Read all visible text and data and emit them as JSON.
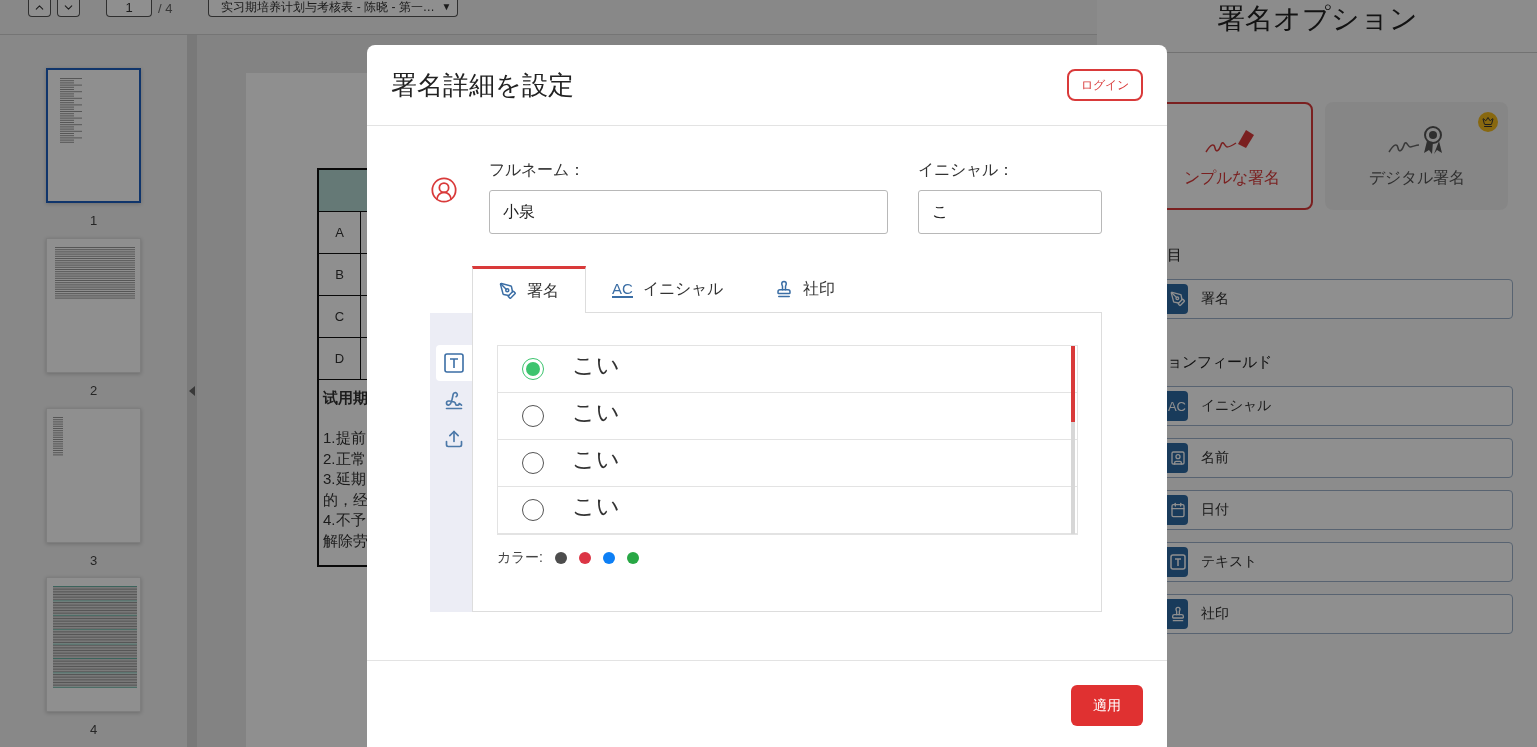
{
  "toolbar": {
    "page_input": "1",
    "page_total": "/ 4",
    "document_select": "实习期培养计划与考核表 - 陈晓 - 第一…",
    "select_caret": "▼"
  },
  "thumbnails": [
    {
      "label": "1",
      "selected": true,
      "kind": "table"
    },
    {
      "label": "2",
      "selected": false,
      "kind": "text"
    },
    {
      "label": "3",
      "selected": false,
      "kind": "narrow"
    },
    {
      "label": "4",
      "selected": false,
      "kind": "dense"
    }
  ],
  "document": {
    "table_rows": [
      "A",
      "B",
      "C",
      "D"
    ],
    "note_title": "试用期",
    "note_lines": [
      "1.提前",
      "2.正常",
      "3.延期",
      "的，经",
      "4.不予",
      "解除劳"
    ]
  },
  "options_panel": {
    "title": "署名オプション",
    "signature_types": [
      {
        "label": "ンプルな署名",
        "selected": true,
        "premium": false,
        "kind": "simple"
      },
      {
        "label": "デジタル署名",
        "selected": false,
        "premium": true,
        "kind": "digital"
      }
    ],
    "section_1": "目",
    "primary_fields": [
      {
        "label": "署名",
        "kind": "signature"
      }
    ],
    "section_2": "ョンフィールド",
    "fields": [
      {
        "label": "イニシャル",
        "kind": "initials",
        "icon_text": "AC"
      },
      {
        "label": "名前",
        "kind": "name"
      },
      {
        "label": "日付",
        "kind": "date"
      },
      {
        "label": "テキスト",
        "kind": "text"
      },
      {
        "label": "社印",
        "kind": "stamp"
      }
    ]
  },
  "dialog": {
    "title": "署名詳細を設定",
    "login_button": "ログイン",
    "full_name": {
      "label": "フルネーム：",
      "value": "小泉"
    },
    "initials": {
      "label": "イニシャル：",
      "value": "こ"
    },
    "tabs": [
      {
        "label": "署名",
        "kind": "signature",
        "selected": true
      },
      {
        "label": "イニシャル",
        "kind": "initials",
        "icon_text": "AC",
        "selected": false
      },
      {
        "label": "社印",
        "kind": "stamp",
        "selected": false
      }
    ],
    "tools": [
      {
        "kind": "text",
        "selected": true
      },
      {
        "kind": "draw",
        "selected": false
      },
      {
        "kind": "upload",
        "selected": false
      }
    ],
    "styles": [
      {
        "text": "こい",
        "selected": true
      },
      {
        "text": "こい",
        "selected": false
      },
      {
        "text": "こい",
        "selected": false
      },
      {
        "text": "こい",
        "selected": false
      }
    ],
    "color_label": "カラー:",
    "colors": [
      {
        "color": "#4d4d4d"
      },
      {
        "color": "#dc3545"
      },
      {
        "color": "#0d7ff5"
      },
      {
        "color": "#28a745"
      }
    ],
    "apply_button": "適用"
  }
}
